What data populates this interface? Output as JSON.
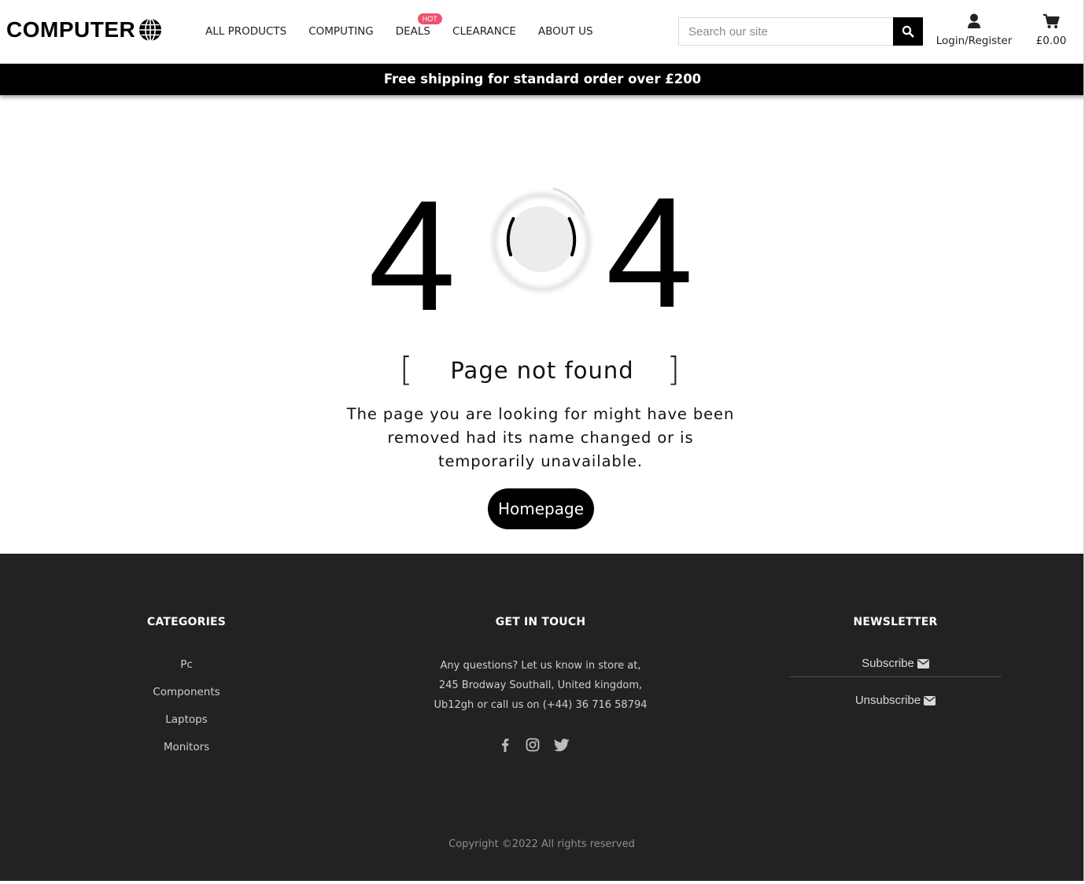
{
  "header": {
    "logo_text": "COMPUTER",
    "nav": [
      {
        "label": "ALL PRODUCTS"
      },
      {
        "label": "COMPUTING"
      },
      {
        "label": "DEALS",
        "badge": "HOT"
      },
      {
        "label": "CLEARANCE"
      },
      {
        "label": "ABOUT US"
      }
    ],
    "search_placeholder": "Search our site",
    "account_label": "Login/Register",
    "cart_total": "£0.00",
    "icons": {
      "logo": "globe-icon",
      "search": "search-icon",
      "account": "user-icon",
      "cart": "cart-icon"
    }
  },
  "promo": {
    "text": "Free shipping for standard order over £200"
  },
  "error": {
    "digit_left": "4",
    "digit_right": "4",
    "bracket_left": "[",
    "bracket_right": "]",
    "title": "Page not found",
    "message": "The page you are looking for might have been removed had its name changed or is temporarily unavailable.",
    "button": "Homepage"
  },
  "footer": {
    "categories": {
      "title": "CATEGORIES",
      "links": [
        "Pc",
        "Components",
        "Laptops",
        "Monitors"
      ]
    },
    "contact": {
      "title": "GET IN TOUCH",
      "lines": [
        "Any questions? Let us know in store at,",
        "245 Brodway Southall, United kingdom,",
        "Ub12gh or call us on (+44) 36 716 58794"
      ],
      "social": [
        "facebook-icon",
        "instagram-icon",
        "twitter-icon"
      ]
    },
    "newsletter": {
      "title": "NEWSLETTER",
      "subscribe": "Subscribe",
      "unsubscribe": "Unsubscribe"
    },
    "copyright": "Copyright ©2022 All rights reserved"
  },
  "colors": {
    "accent": "#000000",
    "hot_badge": "#f0506e",
    "footer_bg": "#222222"
  }
}
